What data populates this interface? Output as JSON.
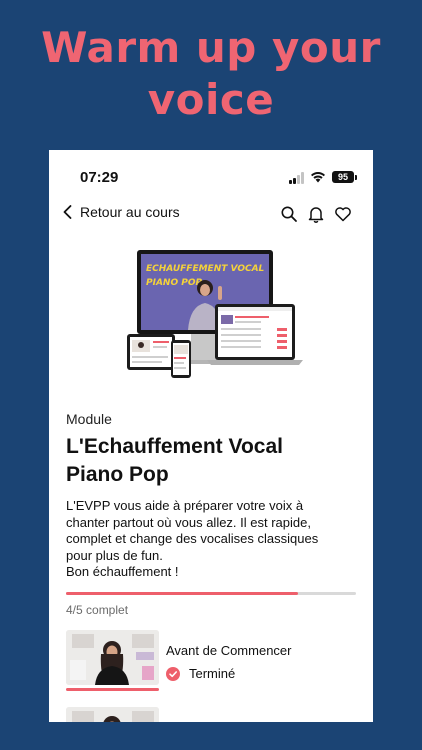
{
  "headline": {
    "line1": "Warm up your",
    "line2": "voice"
  },
  "status_bar": {
    "time": "07:29",
    "battery": "95"
  },
  "nav": {
    "back_label": "Retour au cours",
    "icons": [
      "search-icon",
      "bell-icon",
      "heart-icon"
    ]
  },
  "hero": {
    "screen_title_line1": "ECHAUFFEMENT VOCAL",
    "screen_title_line2": "PIANO POP"
  },
  "module": {
    "kicker": "Module",
    "title_line1": "L'Echauffement Vocal",
    "title_line2": "Piano Pop",
    "description_line1": "L'EVPP vous aide à préparer votre voix à",
    "description_line2": "chanter partout où vous allez. Il est rapide,",
    "description_line3": "complet et change des vocalises classiques",
    "description_line4": "pour plus de fun.",
    "description_line5": "Bon échauffement !"
  },
  "progress": {
    "label": "4/5 complet",
    "fraction": 0.8
  },
  "lessons": [
    {
      "title": "Avant de Commencer",
      "status": "Terminé"
    }
  ],
  "colors": {
    "background": "#1b4474",
    "accent": "#ee5f6b",
    "headline": "#ef6572",
    "hero_screen": "#6a65b0",
    "hero_text": "#f4d23a"
  }
}
